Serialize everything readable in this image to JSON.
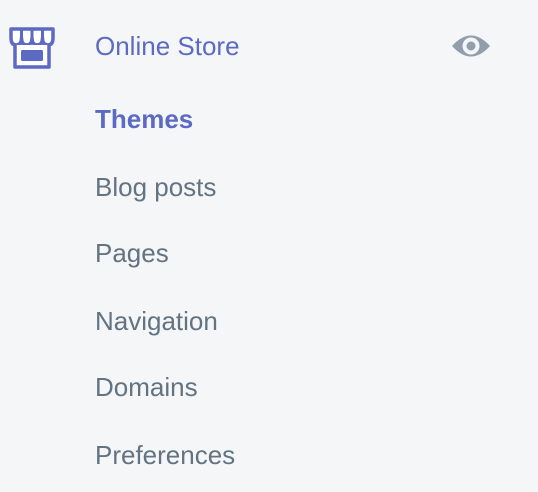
{
  "sidebar": {
    "section": {
      "title": "Online Store",
      "icon": "store-icon",
      "action_icon": "eye-icon"
    },
    "items": [
      {
        "label": "Themes",
        "active": true
      },
      {
        "label": "Blog posts",
        "active": false
      },
      {
        "label": "Pages",
        "active": false
      },
      {
        "label": "Navigation",
        "active": false
      },
      {
        "label": "Domains",
        "active": false
      },
      {
        "label": "Preferences",
        "active": false
      }
    ]
  },
  "colors": {
    "background": "#f4f6f8",
    "accent": "#5c6ac4",
    "text_muted": "#637381",
    "icon_muted": "#919eab"
  }
}
